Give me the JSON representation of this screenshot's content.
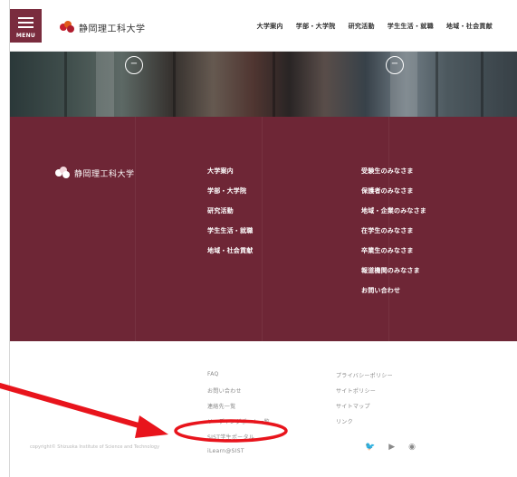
{
  "header": {
    "menu_label": "MENU",
    "logo_text": "静岡理工科大学",
    "nav": [
      "大学案内",
      "学部・大学院",
      "研究活動",
      "学生生活・就職",
      "地域・社会貢献"
    ]
  },
  "hero": {
    "prev_icon": "chevron-left-icon",
    "next_icon": "chevron-right-icon"
  },
  "footer": {
    "logo_text": "静岡理工科大学",
    "col1": [
      "大学案内",
      "学部・大学院",
      "研究活動",
      "学生生活・就職",
      "地域・社会貢献"
    ],
    "col2": [
      "受験生のみなさま",
      "保護者のみなさま",
      "地域・企業のみなさま",
      "在学生のみなさま",
      "卒業生のみなさま",
      "報道機関のみなさま",
      "お問い合わせ"
    ]
  },
  "bottom": {
    "col1": [
      "FAQ",
      "お問い合わせ",
      "連絡先一覧",
      "リーディングポート一覧",
      "SIST学生ポータル",
      "iLearn@SIST"
    ],
    "col2": [
      "プライバシーポリシー",
      "サイトポリシー",
      "サイトマップ",
      "リンク"
    ],
    "copyright": "copyright© Shizuoka Institute of Science and Technology",
    "social": [
      "twitter-icon",
      "youtube-icon",
      "instagram-icon"
    ]
  },
  "colors": {
    "brand": "#7a2c3e",
    "footer_bg": "#6e2636",
    "annotation": "#e8141c"
  }
}
